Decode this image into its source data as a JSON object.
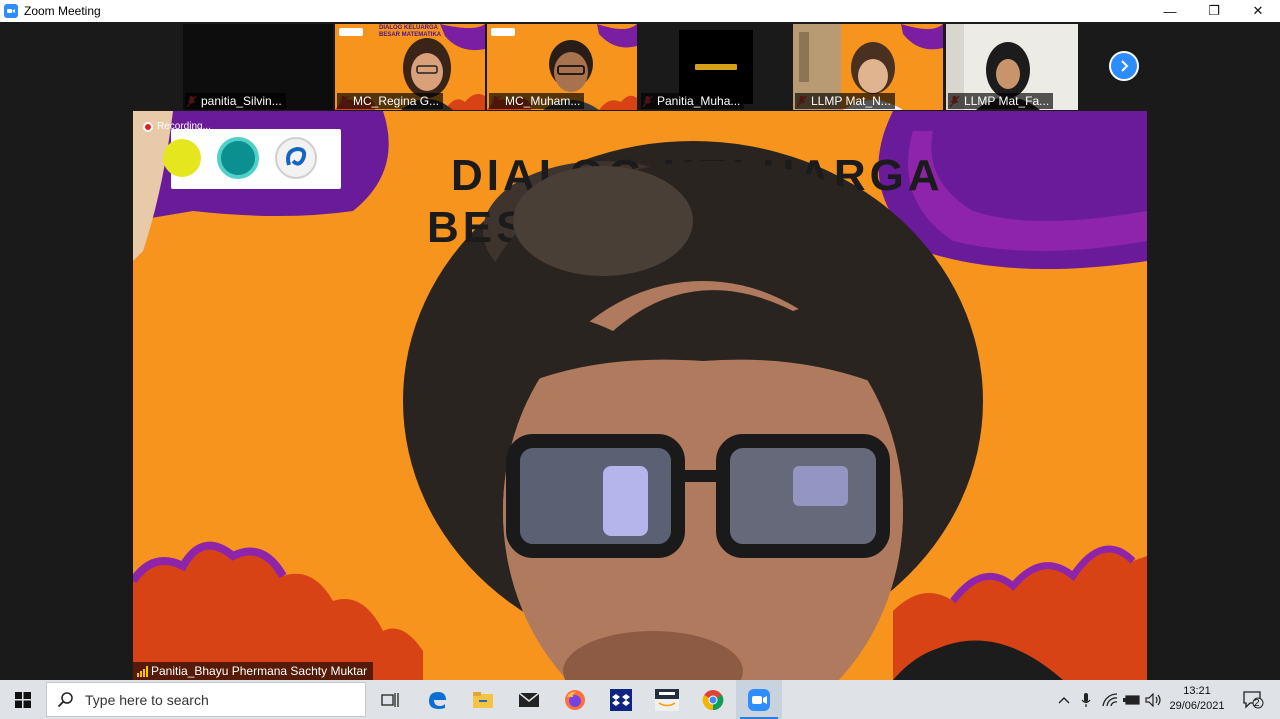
{
  "window": {
    "title": "Zoom Meeting",
    "controls": {
      "minimize": "—",
      "restore": "❐",
      "close": "✕"
    }
  },
  "participants": [
    {
      "name": "panitia_Silvin...",
      "muted": true
    },
    {
      "name": "MC_Regina G...",
      "muted": true
    },
    {
      "name": "MC_Muham...",
      "muted": true
    },
    {
      "name": "Panitia_Muha...",
      "muted": true
    },
    {
      "name": "LLMP Mat_N...",
      "muted": true
    },
    {
      "name": "LLMP Mat_Fa...",
      "muted": true
    }
  ],
  "thumb_banner": {
    "line1": "DIALOG KELUARGA",
    "line2": "BESAR MATEMATIKA"
  },
  "main_video": {
    "recording_label": "Recording...",
    "speaker_name": "Panitia_Bhayu Phermana Sachty Muktar",
    "banner_line1": "DIALOG KELUARGA",
    "banner_line2": "BESAR MATEMATIKA"
  },
  "taskbar": {
    "search_placeholder": "Type here to search",
    "apps": [
      "task-view",
      "edge",
      "file-explorer",
      "mail",
      "firefox",
      "dropbox",
      "amazon",
      "chrome",
      "zoom"
    ],
    "active_app": "zoom",
    "clock_time": "13:21",
    "clock_date": "29/06/2021",
    "notification_count": "2"
  },
  "colors": {
    "zoom_blue": "#2d8cff",
    "banner_orange": "#f7941d",
    "banner_purple": "#7b1fa2",
    "muted_red": "#e53935"
  }
}
